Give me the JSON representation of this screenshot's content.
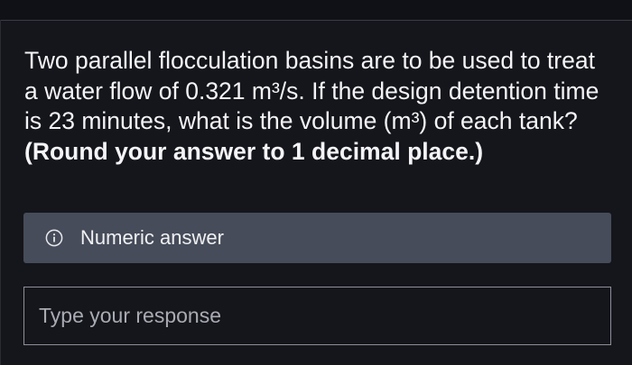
{
  "question": {
    "text": "Two parallel flocculation basins are to be used to treat a water flow of 0.321 m³/s. If the design detention time is 23 minutes, what is the volume (m³) of each tank?",
    "instruction": "(Round your answer to 1 decimal place.)"
  },
  "answer_type": {
    "icon": "info-icon",
    "label": "Numeric answer"
  },
  "response": {
    "value": "",
    "placeholder": "Type your response"
  },
  "colors": {
    "background": "#15161c",
    "info_bar": "#464c59",
    "text": "#f4f4f6",
    "field_border": "#8d8f99"
  }
}
